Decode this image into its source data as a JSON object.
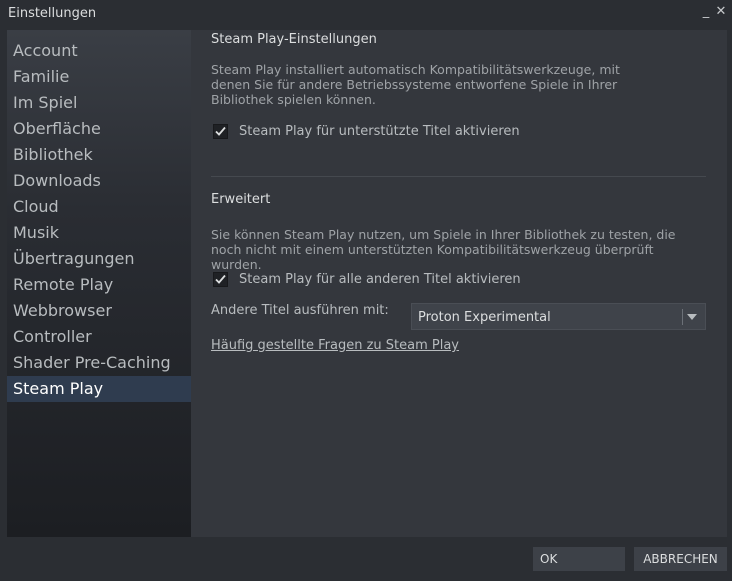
{
  "window": {
    "title": "Einstellungen",
    "minimize_glyph": "_",
    "close_glyph": "✕"
  },
  "sidebar": {
    "items": [
      {
        "label": "Account",
        "active": false
      },
      {
        "label": "Familie",
        "active": false
      },
      {
        "label": "Im Spiel",
        "active": false
      },
      {
        "label": "Oberfläche",
        "active": false
      },
      {
        "label": "Bibliothek",
        "active": false
      },
      {
        "label": "Downloads",
        "active": false
      },
      {
        "label": "Cloud",
        "active": false
      },
      {
        "label": "Musik",
        "active": false
      },
      {
        "label": "Übertragungen",
        "active": false
      },
      {
        "label": "Remote Play",
        "active": false
      },
      {
        "label": "Webbrowser",
        "active": false
      },
      {
        "label": "Controller",
        "active": false
      },
      {
        "label": "Shader Pre-Caching",
        "active": false
      },
      {
        "label": "Steam Play",
        "active": true
      }
    ]
  },
  "main": {
    "section1": {
      "title": "Steam Play-Einstellungen",
      "description": "Steam Play installiert automatisch Kompatibilitätswerkzeuge, mit denen Sie für andere Betriebssysteme entworfene Spiele in Ihrer Bibliothek spielen können.",
      "checkbox_label": "Steam Play für unterstützte Titel aktivieren",
      "checkbox_checked": true
    },
    "section2": {
      "title": "Erweitert",
      "description": "Sie können Steam Play nutzen, um Spiele in Ihrer Bibliothek zu testen, die noch nicht mit einem unterstützten Kompatibilitätswerkzeug überprüft wurden.",
      "checkbox_label": "Steam Play für alle anderen Titel aktivieren",
      "checkbox_checked": true,
      "run_with_label": "Andere Titel ausführen mit:",
      "run_with_value": "Proton Experimental",
      "faq_link": "Häufig gestellte Fragen zu Steam Play"
    }
  },
  "footer": {
    "ok_label": "OK",
    "cancel_label": "ABBRECHEN"
  },
  "colors": {
    "background": "#2b2e33",
    "content": "#34373d",
    "active_item": "#2f3c4f"
  }
}
